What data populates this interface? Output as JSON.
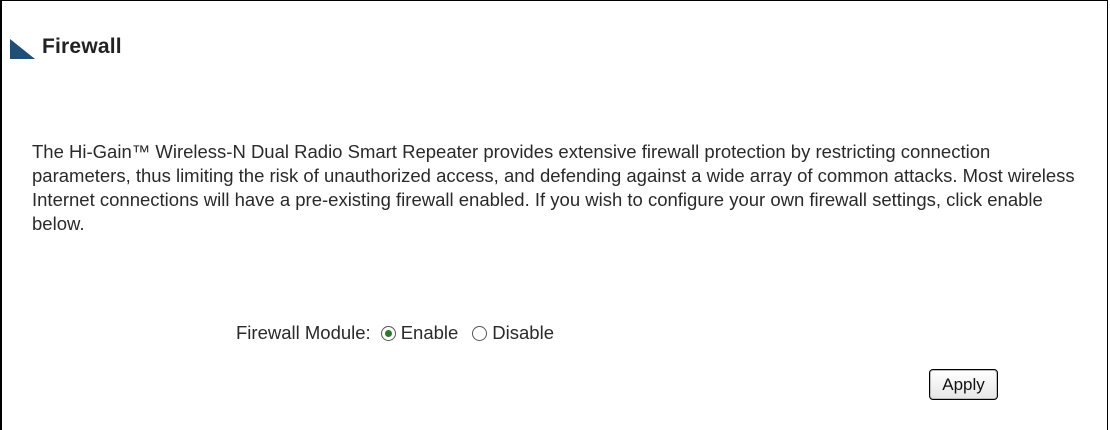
{
  "section": {
    "title": "Firewall"
  },
  "description": "The Hi-Gain™ Wireless-N Dual Radio Smart Repeater provides extensive firewall protection by restricting connection parameters, thus limiting the risk of unauthorized access, and defending against a wide array of common attacks. Most wireless Internet connections will have a pre-existing firewall enabled. If you wish to configure your own firewall settings, click enable below.",
  "firewall_module": {
    "label": "Firewall Module:",
    "options": [
      {
        "label": "Enable",
        "selected": true
      },
      {
        "label": "Disable",
        "selected": false
      }
    ]
  },
  "apply_button": {
    "label": "Apply"
  },
  "colors": {
    "title_marker": "#1f4e78",
    "radio_selected": "#2b7a2b"
  },
  "icons": {
    "title_marker": "triangle-marker-icon",
    "radio_selected": "radio-selected-icon",
    "radio_unselected": "radio-unselected-icon"
  }
}
